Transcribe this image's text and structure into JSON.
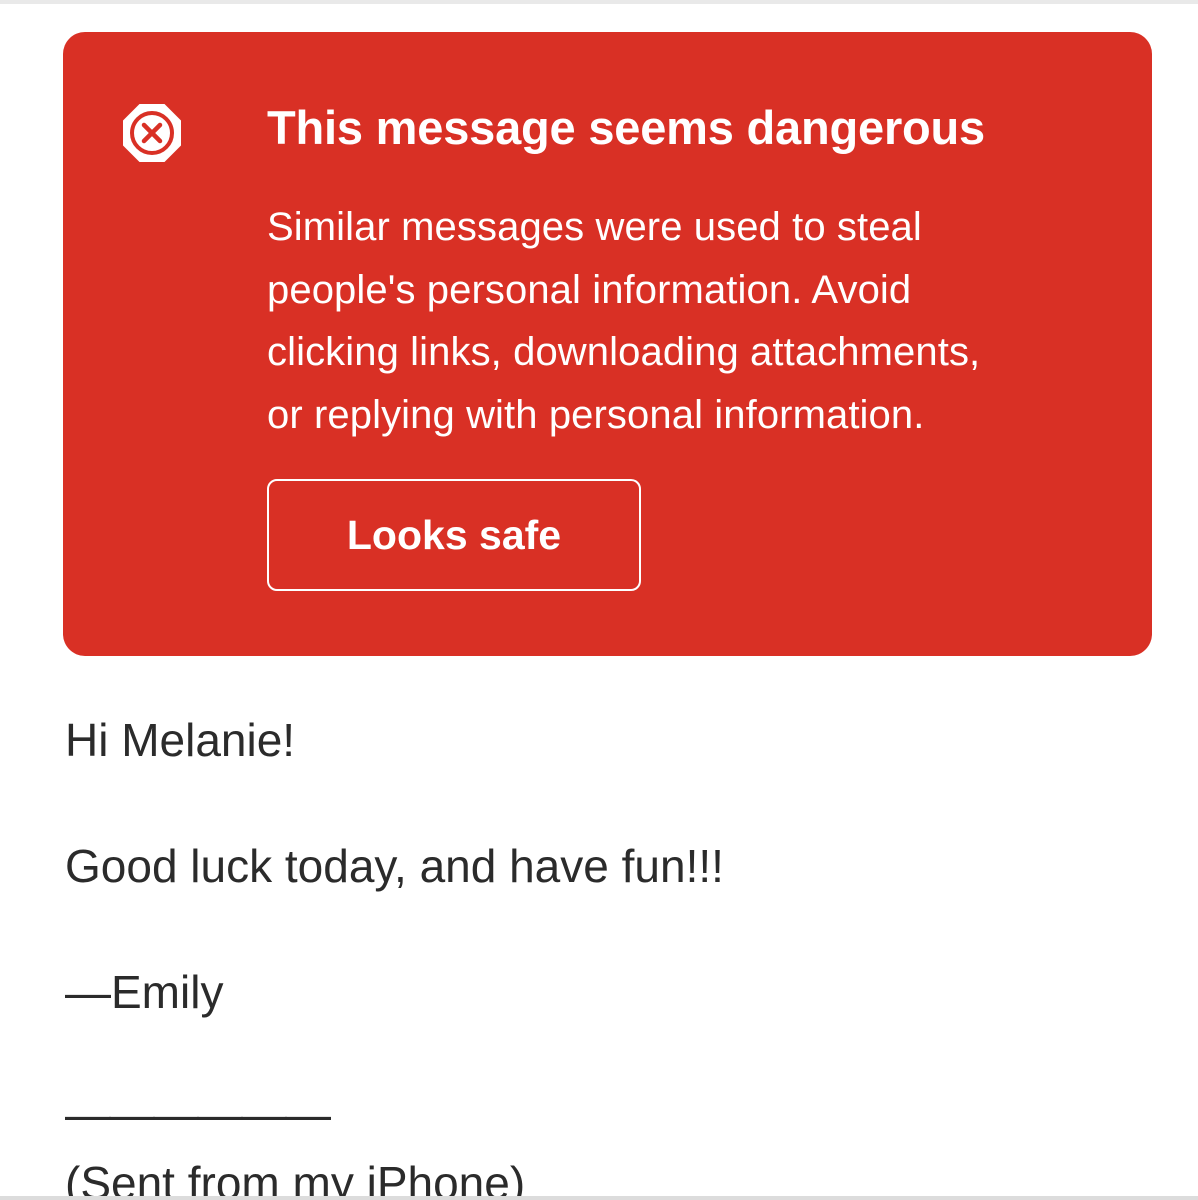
{
  "warning": {
    "icon": "octagon-x-icon",
    "title": "This message seems dangerous",
    "body_lines": [
      "Similar messages were used to steal",
      "people's personal information. Avoid",
      "clicking links, downloading attachments,",
      "or replying with personal information."
    ],
    "button_label": "Looks safe",
    "color": "#d93025"
  },
  "message": {
    "greeting": "Hi Melanie!",
    "body": "Good luck today, and have fun!!!",
    "signature": "—Emily",
    "separator": "——————",
    "sent_from": "(Sent from my iPhone)"
  }
}
